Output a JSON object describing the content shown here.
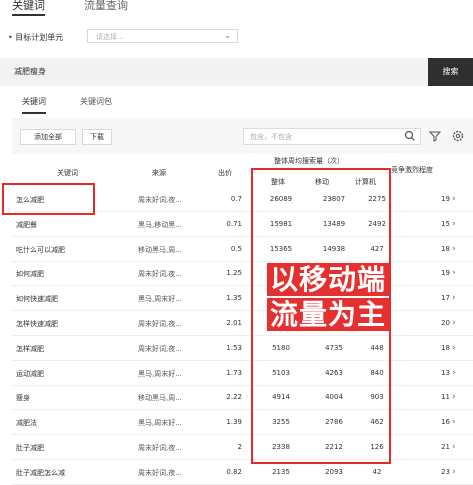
{
  "top_tabs": {
    "active": "关键词",
    "other": "流量查询"
  },
  "unit": {
    "label": "• 目标计划单元",
    "placeholder": "请选择..."
  },
  "search": {
    "value": "减肥瘦身",
    "button": "搜索"
  },
  "sub_tabs": [
    "关键词",
    "关键词包"
  ],
  "toolbar": {
    "add_all": "添加全部",
    "download": "下载",
    "filter_placeholder": "包含，不包含"
  },
  "table": {
    "headers": {
      "keyword": "关键词",
      "source": "来源",
      "bid": "出价",
      "search_volume": "整体周均搜索量（次）",
      "total": "整体",
      "mobile": "移动",
      "pc": "计算机",
      "competition": "竞争激烈程度"
    },
    "rows": [
      {
        "keyword": "怎么减肥",
        "source": "周末好词,夜...",
        "bid": "0.7",
        "total": "26089",
        "mobile": "23807",
        "pc": "2275",
        "competition": "19"
      },
      {
        "keyword": "减肥餐",
        "source": "黑马,移动黑...",
        "bid": "0.71",
        "total": "15981",
        "mobile": "13489",
        "pc": "2492",
        "competition": "15"
      },
      {
        "keyword": "吃什么可以减肥",
        "source": "移动黑马,周...",
        "bid": "0.5",
        "total": "15365",
        "mobile": "14938",
        "pc": "427",
        "competition": "18"
      },
      {
        "keyword": "如何减肥",
        "source": "周末好词,夜...",
        "bid": "1.25",
        "total": "",
        "mobile": "",
        "pc": "",
        "competition": "19"
      },
      {
        "keyword": "如何快速减肥",
        "source": "黑马,周末好...",
        "bid": "1.35",
        "total": "",
        "mobile": "",
        "pc": "",
        "competition": "17"
      },
      {
        "keyword": "怎样快速减肥",
        "source": "周末好词,夜...",
        "bid": "2.01",
        "total": "",
        "mobile": "",
        "pc": "",
        "competition": "20"
      },
      {
        "keyword": "怎样减肥",
        "source": "周末好词,夜...",
        "bid": "1.53",
        "total": "5180",
        "mobile": "4735",
        "pc": "448",
        "competition": "18"
      },
      {
        "keyword": "运动减肥",
        "source": "黑马,周末好...",
        "bid": "1.73",
        "total": "5103",
        "mobile": "4263",
        "pc": "840",
        "competition": "13"
      },
      {
        "keyword": "瘦身",
        "source": "移动黑马,周...",
        "bid": "2.22",
        "total": "4914",
        "mobile": "4004",
        "pc": "903",
        "competition": "11"
      },
      {
        "keyword": "减肥法",
        "source": "黑马,周末好...",
        "bid": "1.39",
        "total": "3255",
        "mobile": "2786",
        "pc": "462",
        "competition": "16"
      },
      {
        "keyword": "肚子减肥",
        "source": "周末好词,夜...",
        "bid": "2",
        "total": "2338",
        "mobile": "2212",
        "pc": "126",
        "competition": "21"
      },
      {
        "keyword": "肚子减肥怎么减",
        "source": "周末好词,夜...",
        "bid": "0.82",
        "total": "2135",
        "mobile": "2093",
        "pc": "42",
        "competition": "23"
      }
    ]
  },
  "annotation": {
    "line1": "以移动端",
    "line2": "流量为主"
  },
  "colors": {
    "highlight": "#e52a2a",
    "search_button": "#2f2f2f"
  },
  "icons": [
    "chevron-down-icon",
    "search-icon",
    "funnel-icon",
    "gear-icon",
    "chevron-right-icon"
  ]
}
